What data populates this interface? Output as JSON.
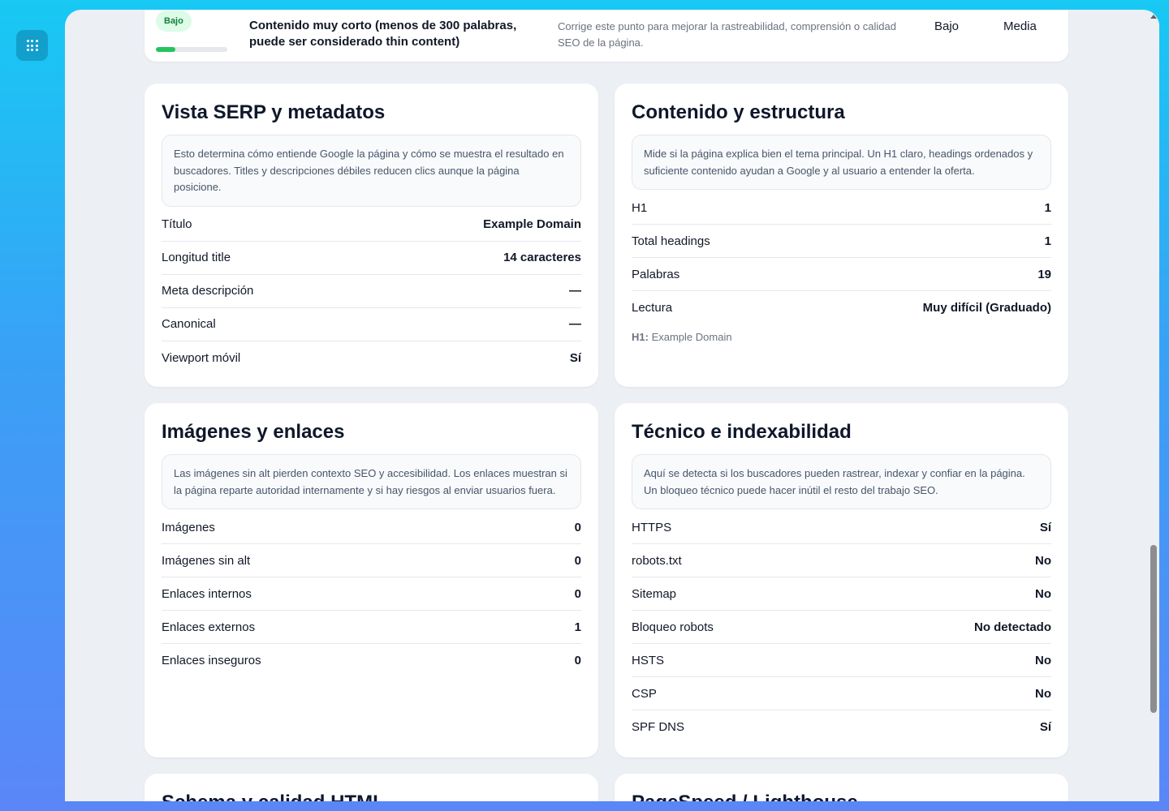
{
  "apps_icon": "apps-grid-icon",
  "issue": {
    "badge": "Bajo",
    "score_fraction": 0.27,
    "title": "Contenido muy corto (menos de 300 palabras, puede ser considerado thin content)",
    "description": "Corrige este punto para mejorar la rastreabilidad, comprensión o calidad SEO de la página.",
    "impact": "Bajo",
    "priority": "Media",
    "colors": {
      "badge_bg": "#dcfce7",
      "badge_text": "#15803d",
      "bar": "#22c55e"
    }
  },
  "cards": {
    "serp": {
      "title": "Vista SERP y metadatos",
      "note": "Esto determina cómo entiende Google la página y cómo se muestra el resultado en buscadores. Titles y descripciones débiles reducen clics aunque la página posicione.",
      "rows": [
        {
          "label": "Título",
          "value": "Example Domain"
        },
        {
          "label": "Longitud title",
          "value": "14 caracteres"
        },
        {
          "label": "Meta descripción",
          "value": "—"
        },
        {
          "label": "Canonical",
          "value": "—"
        },
        {
          "label": "Viewport móvil",
          "value": "Sí"
        }
      ]
    },
    "content": {
      "title": "Contenido y estructura",
      "note": "Mide si la página explica bien el tema principal. Un H1 claro, headings ordenados y suficiente contenido ayudan a Google y al usuario a entender la oferta.",
      "rows": [
        {
          "label": "H1",
          "value": "1"
        },
        {
          "label": "Total headings",
          "value": "1"
        },
        {
          "label": "Palabras",
          "value": "19"
        },
        {
          "label": "Lectura",
          "value": "Muy difícil (Graduado)"
        }
      ],
      "h1_prefix": "H1:",
      "h1_value": "Example Domain"
    },
    "images": {
      "title": "Imágenes y enlaces",
      "note": "Las imágenes sin alt pierden contexto SEO y accesibilidad. Los enlaces muestran si la página reparte autoridad internamente y si hay riesgos al enviar usuarios fuera.",
      "rows": [
        {
          "label": "Imágenes",
          "value": "0"
        },
        {
          "label": "Imágenes sin alt",
          "value": "0"
        },
        {
          "label": "Enlaces internos",
          "value": "0"
        },
        {
          "label": "Enlaces externos",
          "value": "1"
        },
        {
          "label": "Enlaces inseguros",
          "value": "0"
        }
      ]
    },
    "technical": {
      "title": "Técnico e indexabilidad",
      "note": "Aquí se detecta si los buscadores pueden rastrear, indexar y confiar en la página. Un bloqueo técnico puede hacer inútil el resto del trabajo SEO.",
      "rows": [
        {
          "label": "HTTPS",
          "value": "Sí"
        },
        {
          "label": "robots.txt",
          "value": "No"
        },
        {
          "label": "Sitemap",
          "value": "No"
        },
        {
          "label": "Bloqueo robots",
          "value": "No detectado"
        },
        {
          "label": "HSTS",
          "value": "No"
        },
        {
          "label": "CSP",
          "value": "No"
        },
        {
          "label": "SPF DNS",
          "value": "Sí"
        }
      ]
    },
    "schema": {
      "title": "Schema y calidad HTML"
    },
    "pagespeed": {
      "title": "PageSpeed / Lighthouse"
    }
  }
}
